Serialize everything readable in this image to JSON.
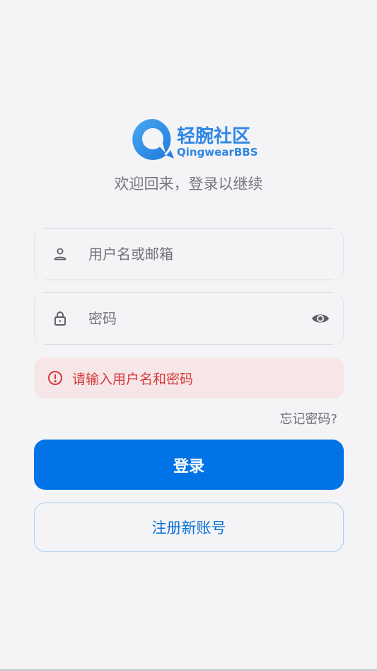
{
  "brand": {
    "name_cn": "轻腕社区",
    "name_en": "QingwearBBS",
    "logo_icon": "chat-bubble-logo-icon",
    "color": "#2f86e4"
  },
  "subtitle": "欢迎回来，登录以继续",
  "username_field": {
    "placeholder": "用户名或邮箱",
    "value": "",
    "icon": "user-icon"
  },
  "password_field": {
    "placeholder": "密码",
    "value": "",
    "icon": "lock-icon",
    "toggle_icon": "eye-icon"
  },
  "error": {
    "message": "请输入用户名和密码",
    "icon": "alert-circle-icon",
    "color": "#d43a3a"
  },
  "forgot_password": "忘记密码?",
  "login_button": "登录",
  "register_button": "注册新账号",
  "colors": {
    "primary": "#0073e6",
    "background": "#f4f4f6",
    "error_bg": "#f7e6e8"
  }
}
